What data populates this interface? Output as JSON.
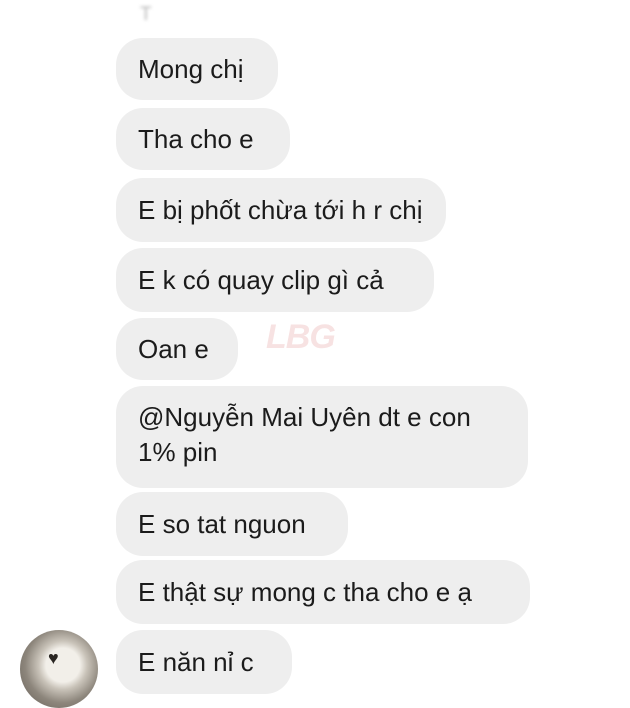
{
  "chat": {
    "sender_name": "T",
    "watermark": "LBG",
    "avatar_icon": "avatar-photo",
    "messages": [
      {
        "text": "Mong chị"
      },
      {
        "text": "Tha cho e"
      },
      {
        "text": "E bị phốt chừa tới h r chị"
      },
      {
        "text": "E k có quay clip gì cả"
      },
      {
        "text": "Oan e"
      },
      {
        "text": "@Nguyễn Mai Uyên dt e con 1% pin"
      },
      {
        "text": "E so tat nguon"
      },
      {
        "text": "E thật sự mong c tha cho e ạ"
      },
      {
        "text": "E năn nỉ c"
      }
    ]
  }
}
